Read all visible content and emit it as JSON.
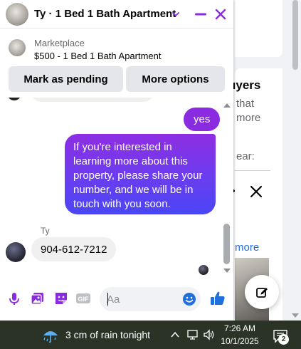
{
  "chat": {
    "title": "Ty · 1 Bed 1 Bath Apartment",
    "marketplace_label": "Marketplace",
    "listing_title": "$500 - 1 Bed 1 Bath Apartment",
    "mark_pending_label": "Mark as pending",
    "more_options_label": "More options",
    "messages": [
      {
        "from": "me",
        "text": "yes"
      },
      {
        "from": "me",
        "text": "If you're interested in learning more about this property, please share your number, and we will be in touch with you soon."
      },
      {
        "from": "Ty",
        "sender_name": "Ty",
        "text": "904-612-7212"
      }
    ],
    "composer_placeholder": "Aa",
    "accent_color": "#8a2be2",
    "icons": [
      "microphone-icon",
      "photo-icon",
      "sticker-icon",
      "gif-icon",
      "emoji-icon",
      "thumbs-up-icon",
      "chevron-down-icon",
      "minimize-icon",
      "close-icon"
    ]
  },
  "background": {
    "heading_fragment": "uyers",
    "line1": "that",
    "line2": "more",
    "line3": "ear:",
    "more_link": "more"
  },
  "taskbar": {
    "weather": "3 cm of rain tonight",
    "time": "7:26 AM",
    "date": "10/1/2025",
    "notification_count": "2"
  }
}
